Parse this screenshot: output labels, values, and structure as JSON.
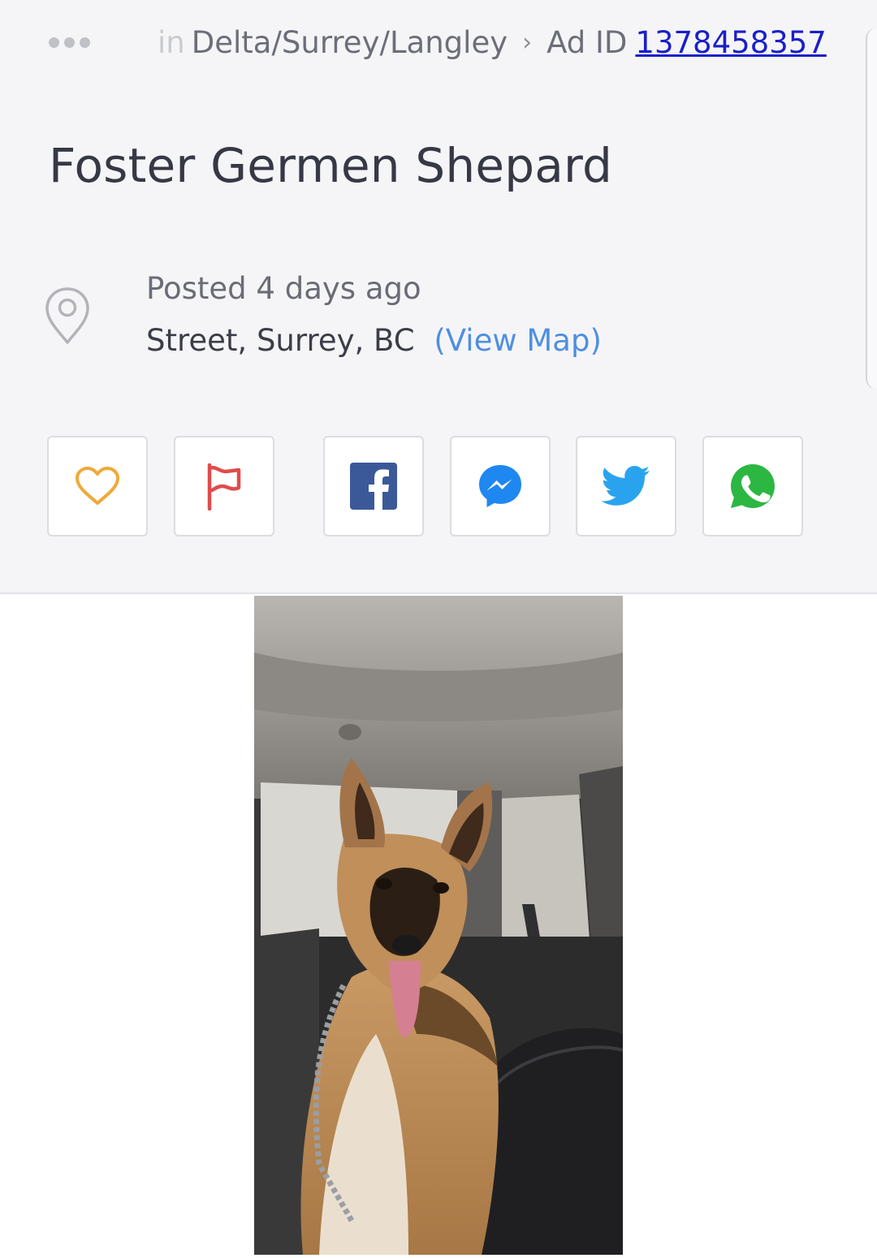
{
  "breadcrumb": {
    "more_icon": "more-dots-icon",
    "prefix": "in",
    "location": "Delta/Surrey/Langley",
    "separator": "›",
    "ad_id_label": "Ad ID",
    "ad_id": "1378458357"
  },
  "listing": {
    "title": "Foster Germen Shepard",
    "posted": "Posted 4 days ago",
    "address": "Street, Surrey, BC",
    "view_map": "(View Map)",
    "location_icon": "location-pin-icon"
  },
  "actions": [
    {
      "icon": "heart-icon",
      "color": "#F0A93A"
    },
    {
      "icon": "flag-icon",
      "color": "#E14B4B"
    },
    {
      "icon": "facebook-icon",
      "color": "#3B5998"
    },
    {
      "icon": "messenger-icon",
      "color": "#1E88F0"
    },
    {
      "icon": "twitter-icon",
      "color": "#2AA3EF"
    },
    {
      "icon": "whatsapp-icon",
      "color": "#2BB741"
    }
  ],
  "photo": {
    "icon": "german-shepherd-photo"
  }
}
